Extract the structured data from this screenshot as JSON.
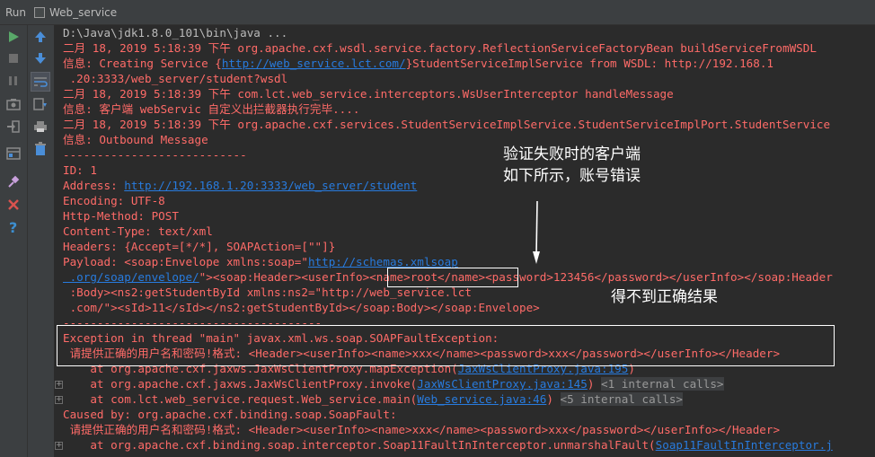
{
  "window": {
    "run_label": "Run",
    "tab_title": "Web_service"
  },
  "toolbar": {
    "colors": {
      "run": "#59a869",
      "stop": "#6e6e6e",
      "up_down": "#4a8ed8",
      "close": "#d9534f",
      "help": "#3d8fd1"
    },
    "buttons": [
      "run-icon",
      "stop-icon",
      "pause-icon",
      "camera-icon",
      "login-icon",
      "layout-icon",
      "pin-icon",
      "close-icon",
      "help-icon",
      "arrow-up-icon",
      "arrow-down-icon",
      "wrap-icon",
      "scroll-to-end-icon",
      "print-icon",
      "trash-icon"
    ]
  },
  "console": {
    "l1": "D:\\Java\\jdk1.8.0_101\\bin\\java ...",
    "l2": "二月 18, 2019 5:18:39 下午 org.apache.cxf.wsdl.service.factory.ReflectionServiceFactoryBean buildServiceFromWSDL",
    "l3a": "信息: Creating Service {",
    "l3link": "http://web_service.lct.com/",
    "l3b": "}StudentServiceImplService from WSDL: http://192.168.1",
    "l4": " .20:3333/web_server/student?wsdl",
    "l5": "二月 18, 2019 5:18:39 下午 com.lct.web_service.interceptors.WsUserInterceptor handleMessage",
    "l6": "信息: 客户端 webServic 自定义出拦截器执行完毕....",
    "l7": "二月 18, 2019 5:18:39 下午 org.apache.cxf.services.StudentServiceImplService.StudentServiceImplPort.StudentService",
    "l8": "信息: Outbound Message",
    "l9": "---------------------------",
    "l10": "ID: 1",
    "l11a": "Address: ",
    "l11link": "http://192.168.1.20:3333/web_server/student",
    "l12": "Encoding: UTF-8",
    "l13": "Http-Method: POST",
    "l14": "Content-Type: text/xml",
    "l15": "Headers: {Accept=[*/*], SOAPAction=[\"\"]}",
    "l16a": "Payload: <soap:Envelope xmlns:soap=\"",
    "l16link": "http://schemas.xmlsoap",
    "l17link": " .org/soap/envelope/",
    "l17b": "\"><soap:Header><userInfo><name>root</name><password>123456</password></userInfo></soap:Header",
    "l18": " :Body><ns2:getStudentById xmlns:ns2=\"http://web_service.lct",
    "l19": " .com/\"><sId>11</sId></ns2:getStudentById></soap:Body></soap:Envelope>",
    "l20": "--------------------------------------",
    "l21": "Exception in thread \"main\" javax.xml.ws.soap.SOAPFaultException:",
    "l22": " 请提供正确的用户名和密码!格式: <Header><userInfo><name>xxx</name><password>xxx</password></userInfo></Header>",
    "l23a": "    at org.apache.cxf.jaxws.JaxWsClientProxy.mapException(",
    "l23link": "JaxWsClientProxy.java:195",
    "l23b": ")",
    "l24a": "    at org.apache.cxf.jaxws.JaxWsClientProxy.invoke(",
    "l24link": "JaxWsClientProxy.java:145",
    "l24b": ") ",
    "l24pill": "<1 internal calls>",
    "l25a": "    at com.lct.web_service.request.Web_service.main(",
    "l25link": "Web_service.java:46",
    "l25b": ") ",
    "l25pill": "<5 internal calls>",
    "l26": "Caused by: org.apache.cxf.binding.soap.SoapFault:",
    "l27": " 请提供正确的用户名和密码!格式: <Header><userInfo><name>xxx</name><password>xxx</password></userInfo></Header>",
    "l28a": "    at org.apache.cxf.binding.soap.interceptor.Soap11FaultInInterceptor.unmarshalFault(",
    "l28link": "Soap11FaultInInterceptor.j"
  },
  "annotations": {
    "note1_line1": "验证失败时的客户端",
    "note1_line2": "如下所示，账号错误",
    "note2": "得不到正确结果"
  }
}
